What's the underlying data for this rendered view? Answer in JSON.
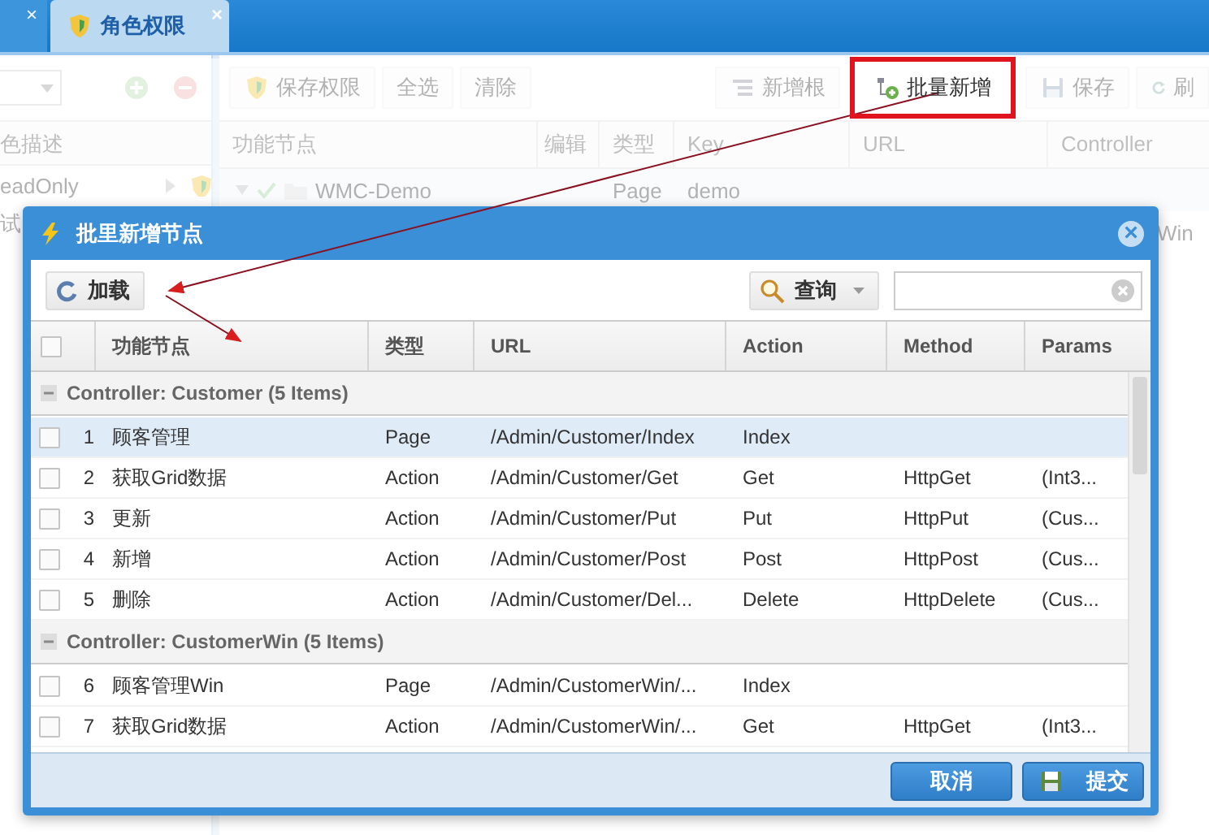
{
  "tabs": [
    {
      "close": "×",
      "selected": false
    },
    {
      "label": "角色权限",
      "close": "×",
      "selected": true
    }
  ],
  "left_panel": {
    "header": "色描述",
    "rows": [
      {
        "text": "eadOnly"
      },
      {
        "text": "试"
      }
    ]
  },
  "toolbar": {
    "left_buttons": [
      {
        "label": "保存权限",
        "kind": "shield"
      },
      {
        "label": "全选",
        "kind": "plain"
      },
      {
        "label": "清除",
        "kind": "plain"
      }
    ],
    "right_buttons": [
      {
        "label": "新增根",
        "kind": "root",
        "highlighted": false
      },
      {
        "label": "批量新增",
        "kind": "batch",
        "highlighted": true
      },
      {
        "label": "保存",
        "kind": "save",
        "highlighted": false
      },
      {
        "label": "刷",
        "kind": "refresh",
        "highlighted": false
      }
    ]
  },
  "tree_grid": {
    "columns": [
      "功能节点",
      "编辑",
      "类型",
      "Key",
      "URL",
      "Controller"
    ],
    "rows": [
      {
        "node": "WMC-Demo",
        "type": "Page",
        "key": "demo",
        "controller": ""
      },
      {
        "node": "",
        "type": "",
        "key": "",
        "controller": "Win"
      }
    ]
  },
  "dialog": {
    "title": "批里新增节点",
    "close": "×",
    "load_button": "加载",
    "query_button": "查询",
    "all_checked": false,
    "columns": [
      "功能节点",
      "类型",
      "URL",
      "Action",
      "Method",
      "Params"
    ],
    "groups": [
      {
        "title": "Controller: Customer (5 Items)",
        "expanded": true,
        "rows": [
          {
            "no": "1",
            "node": "顾客管理",
            "type": "Page",
            "url": "/Admin/Customer/Index",
            "action": "Index",
            "method": "",
            "params": "",
            "checked": false,
            "selected": true
          },
          {
            "no": "2",
            "node": "获取Grid数据",
            "type": "Action",
            "url": "/Admin/Customer/Get",
            "action": "Get",
            "method": "HttpGet",
            "params": "(Int3...",
            "checked": false,
            "selected": false
          },
          {
            "no": "3",
            "node": "更新",
            "type": "Action",
            "url": "/Admin/Customer/Put",
            "action": "Put",
            "method": "HttpPut",
            "params": "(Cus...",
            "checked": false,
            "selected": false
          },
          {
            "no": "4",
            "node": "新增",
            "type": "Action",
            "url": "/Admin/Customer/Post",
            "action": "Post",
            "method": "HttpPost",
            "params": "(Cus...",
            "checked": false,
            "selected": false
          },
          {
            "no": "5",
            "node": "删除",
            "type": "Action",
            "url": "/Admin/Customer/Del...",
            "action": "Delete",
            "method": "HttpDelete",
            "params": "(Cus...",
            "checked": false,
            "selected": false
          }
        ]
      },
      {
        "title": "Controller: CustomerWin (5 Items)",
        "expanded": true,
        "rows": [
          {
            "no": "6",
            "node": "顾客管理Win",
            "type": "Page",
            "url": "/Admin/CustomerWin/...",
            "action": "Index",
            "method": "",
            "params": "",
            "checked": false,
            "selected": false
          },
          {
            "no": "7",
            "node": "获取Grid数据",
            "type": "Action",
            "url": "/Admin/CustomerWin/...",
            "action": "Get",
            "method": "HttpGet",
            "params": "(Int3...",
            "checked": false,
            "selected": false
          }
        ]
      }
    ],
    "buttons": [
      {
        "label": "取消",
        "kind": "cancel"
      },
      {
        "label": "提交",
        "kind": "submit"
      }
    ]
  }
}
